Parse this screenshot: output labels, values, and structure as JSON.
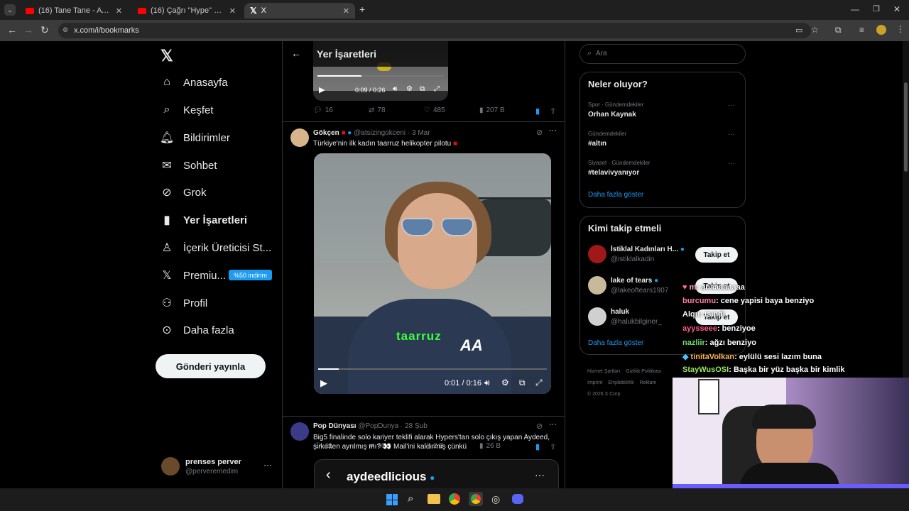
{
  "browser": {
    "tabs": [
      {
        "label": "(16) Tane Tane - AYDEED | Music",
        "icon": "youtube-icon"
      },
      {
        "label": "(16) Çağrı \"Hype\" Ergün - GİTM",
        "icon": "youtube-icon"
      },
      {
        "label": "X",
        "icon": "x-logo-icon"
      }
    ],
    "new_tab": "+",
    "url": "x.com/i/bookmarks"
  },
  "sidebar": {
    "items": [
      {
        "label": "Anasayfa",
        "icon": "home-icon"
      },
      {
        "label": "Keşfet",
        "icon": "search-icon"
      },
      {
        "label": "Bildirimler",
        "icon": "bell-icon"
      },
      {
        "label": "Sohbet",
        "icon": "mail-icon"
      },
      {
        "label": "Grok",
        "icon": "grok-icon"
      },
      {
        "label": "Yer İşaretleri",
        "icon": "bookmark-icon"
      },
      {
        "label": "İçerik Üreticisi St...",
        "icon": "creator-icon"
      },
      {
        "label": "Premiu...",
        "icon": "x-premium-icon"
      },
      {
        "label": "Profil",
        "icon": "person-icon"
      },
      {
        "label": "Daha fazla",
        "icon": "more-circle-icon"
      }
    ],
    "premium_badge": "%50 indirim",
    "post_button": "Gönderi yayınla",
    "account": {
      "name": "prenses perver",
      "handle": "@perveremedim"
    }
  },
  "header": {
    "title": "Yer İşaretleri"
  },
  "top_video": {
    "time": "0:09 / 0:26",
    "replies": "16",
    "reposts": "78",
    "likes": "485",
    "views": "207 B"
  },
  "tweet1": {
    "name": "Gökçen",
    "handle": "@atsizingokceni",
    "date": "· 3 Mar",
    "text": "Türkiye'nin ilk kadın taarruz helikopter pilotu",
    "video_caption": "taarruz",
    "video_logo": "AA",
    "video_time": "0:01 / 0:16",
    "replies": "11",
    "reposts": "60",
    "likes": "2 B",
    "views": "26 B"
  },
  "tweet2": {
    "name": "Pop Dünyası",
    "handle": "@PopDunya",
    "date": "· 28 Şub",
    "text": "Big5 finalinde solo kariyer teklifi alarak Hypers'tan solo çıkış yapan Aydeed, şirketten ayrılmış mı? 👀 Mail'ini kaldırmış çünkü",
    "embed_name": "aydeedlicious"
  },
  "search": {
    "placeholder": "Ara"
  },
  "trends": {
    "title": "Neler oluyor?",
    "items": [
      {
        "context": "Spor · Gündemdekiler",
        "name": "Orhan Kaynak"
      },
      {
        "context": "Gündemdekiler",
        "name": "#altın"
      },
      {
        "context": "Siyaset · Gündemdekiler",
        "name": "#telavivyanıyor"
      }
    ],
    "more": "Daha fazla göster"
  },
  "who_to_follow": {
    "title": "Kimi takip etmeli",
    "items": [
      {
        "name": "İstiklal Kadınları H...",
        "handle": "@istiklalkadin",
        "button": "Takip et"
      },
      {
        "name": "lake of tears",
        "handle": "@lakeoftears1907",
        "button": "Takip et"
      },
      {
        "name": "haluk",
        "handle": "@halukbilginer_",
        "button": "Takip et"
      }
    ],
    "more": "Daha fazla göster"
  },
  "footer": {
    "links": [
      "Hizmet Şartları",
      "Gizlilik Politikası",
      "Imprint",
      "Erişilebilirlik",
      "Reklam"
    ],
    "copyright": "© 2026 X Corp."
  },
  "chat": [
    {
      "user": "m",
      "text": ": anaaaaaaaa",
      "color": "#ff6b9d"
    },
    {
      "user": "burcumu",
      "text": ": cene yapisi baya benziyo",
      "color": "#ff7aa8"
    },
    {
      "user": "Alqu",
      "text": ": ısındı",
      "color": "#ffffff"
    },
    {
      "user": "ayysseee",
      "text": ": benziyoe",
      "color": "#ff5c8a"
    },
    {
      "user": "nazliir",
      "text": ": ağzı benziyo",
      "color": "#6ee06e"
    },
    {
      "user": "tinitaVolkan",
      "text": ": eylülü sesi lazım buna",
      "color": "#ffb347"
    },
    {
      "user": "StayWusOSI",
      "text": ": Başka bir yüz başka bir kimlik",
      "color": "#9be564"
    }
  ],
  "colors": {
    "accent": "#1d9bf0",
    "bg": "#000000",
    "border": "#2f3336"
  }
}
